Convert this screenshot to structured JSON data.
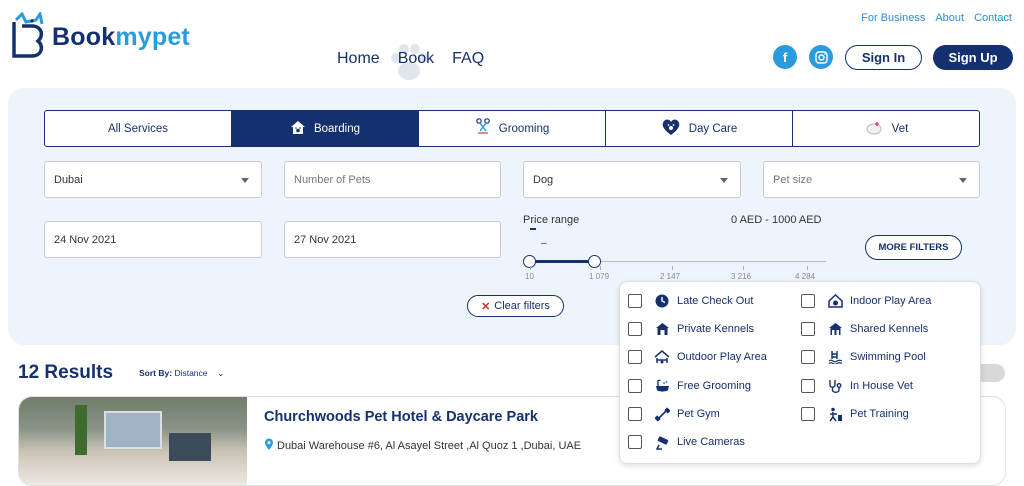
{
  "brand": {
    "name_part1": "Book",
    "name_part2": "mypet"
  },
  "nav": {
    "items": [
      "Home",
      "Book",
      "FAQ"
    ]
  },
  "top_links": [
    "For Business",
    "About",
    "Contact"
  ],
  "auth": {
    "sign_in": "Sign In",
    "sign_up": "Sign Up"
  },
  "service_tabs": [
    {
      "label": "All Services",
      "active": false
    },
    {
      "label": "Boarding",
      "active": true
    },
    {
      "label": "Grooming",
      "active": false
    },
    {
      "label": "Day Care",
      "active": false
    },
    {
      "label": "Vet",
      "active": false
    }
  ],
  "search": {
    "city": "Dubai",
    "pets_placeholder": "Number of Pets",
    "pet_type": "Dog",
    "pet_size_placeholder": "Pet size",
    "check_in": "24 Nov 2021",
    "check_out": "27 Nov 2021"
  },
  "price": {
    "label": "Price range",
    "value_text": "0 AED - 1000 AED",
    "dash": "–",
    "ticks": [
      "10",
      "1 079",
      "2 147",
      "3 216",
      "4 284"
    ]
  },
  "buttons": {
    "more_filters": "MORE FILTERS",
    "clear_filters": "Clear filters"
  },
  "results": {
    "count_text": "12 Results",
    "sort_label": "Sort By:",
    "sort_value": "Distance"
  },
  "listing": {
    "title": "Churchwoods Pet Hotel & Daycare Park",
    "address": "Dubai Warehouse #6, Al Asayel Street ,Al Quoz 1 ,Dubai, UAE"
  },
  "filters": [
    {
      "label": "Late Check Out",
      "icon": "clock-icon",
      "checked": false
    },
    {
      "label": "Indoor Play Area",
      "icon": "indoor-play-icon",
      "checked": false
    },
    {
      "label": "Private Kennels",
      "icon": "kennel-icon",
      "checked": false
    },
    {
      "label": "Shared Kennels",
      "icon": "shared-kennel-icon",
      "checked": false
    },
    {
      "label": "Outdoor Play Area",
      "icon": "outdoor-play-icon",
      "checked": false
    },
    {
      "label": "Swimming Pool",
      "icon": "pool-icon",
      "checked": false
    },
    {
      "label": "Free Grooming",
      "icon": "bath-icon",
      "checked": false
    },
    {
      "label": "In House Vet",
      "icon": "stethoscope-icon",
      "checked": false
    },
    {
      "label": "Pet Gym",
      "icon": "dumbbell-icon",
      "checked": false
    },
    {
      "label": "Pet Training",
      "icon": "training-icon",
      "checked": false
    },
    {
      "label": "Live Cameras",
      "icon": "camera-icon",
      "checked": false
    }
  ],
  "colors": {
    "primary": "#15306e",
    "accent": "#2b9be0",
    "panel": "#eef4fb",
    "danger": "#d62c2c"
  }
}
